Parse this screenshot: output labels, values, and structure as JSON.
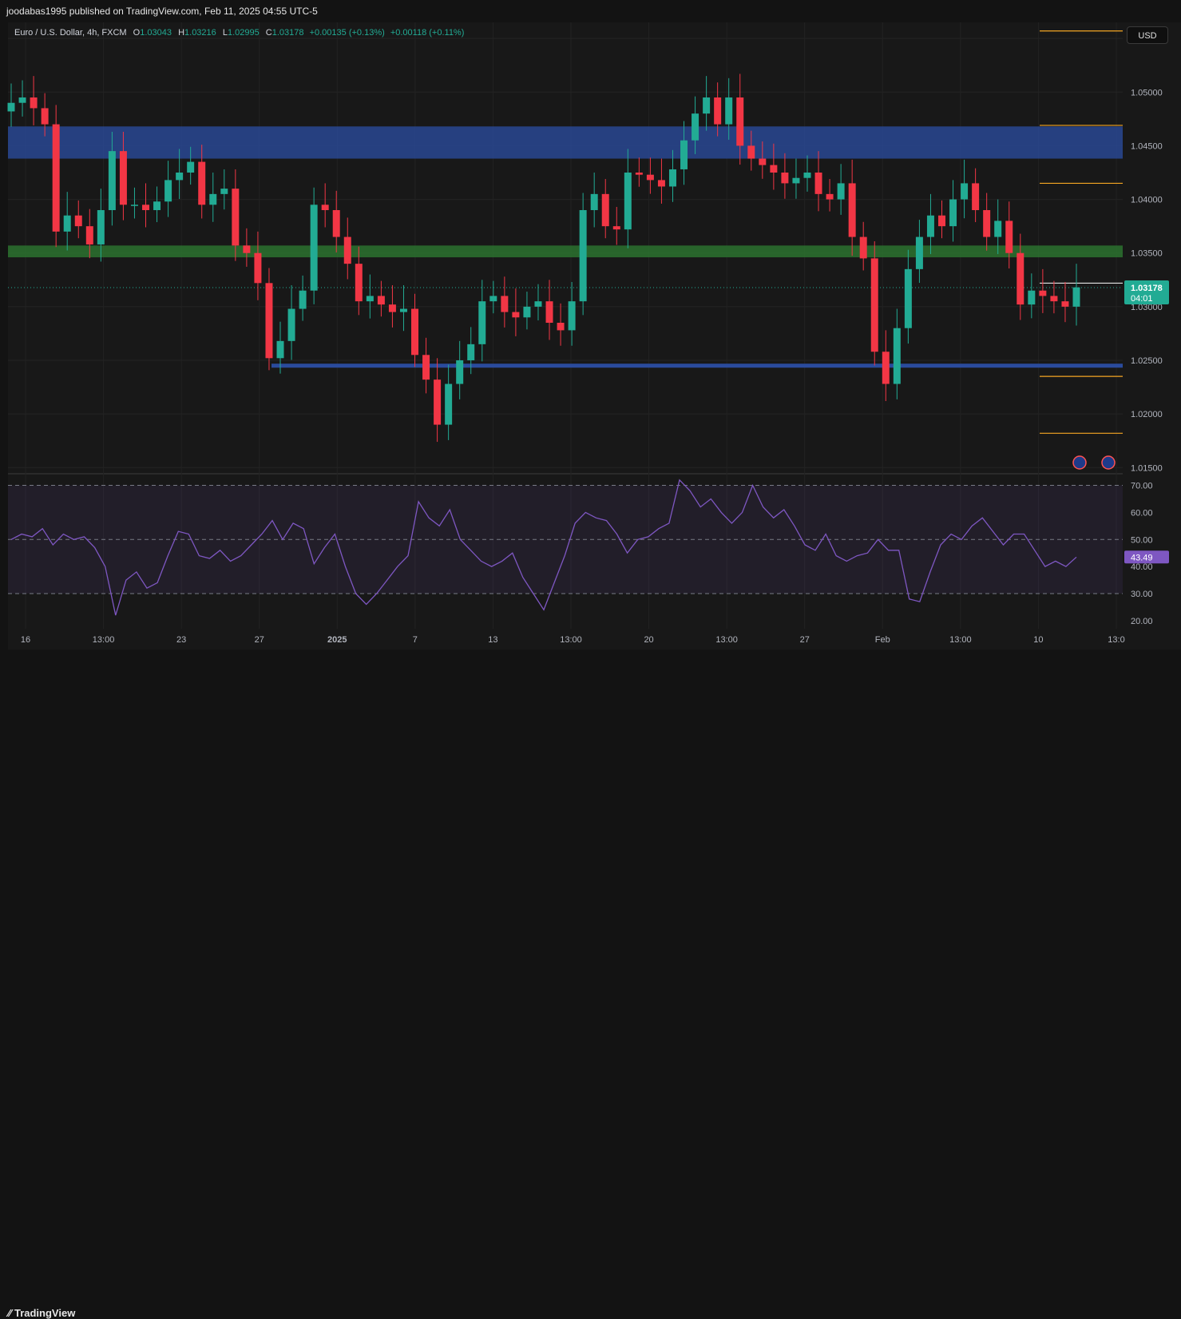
{
  "header": {
    "publisher_line": "joodabas1995 published on TradingView.com, Feb 11, 2025 04:55 UTC-5"
  },
  "legend": {
    "symbol": "Euro / U.S. Dollar, 4h, FXCM",
    "open_label": "O",
    "open": "1.03043",
    "high_label": "H",
    "high": "1.03216",
    "low_label": "L",
    "low": "1.02995",
    "close_label": "C",
    "close": "1.03178",
    "change": "+0.00135 (+0.13%)",
    "change2": "+0.00118 (+0.11%)"
  },
  "currency_button": "USD",
  "last_price": {
    "value": "1.03178",
    "countdown": "04:01",
    "color": "#22ab94"
  },
  "rsi_value": {
    "value": "43.49",
    "color": "#7e57c2"
  },
  "footer": {
    "brand": "TradingView"
  },
  "colors": {
    "up": "#22ab94",
    "down": "#f23645",
    "supply_zone": "#2b4ea3",
    "demand_zone": "#2e7d32",
    "support_line": "#2b4ea3",
    "rsi": "#7e57c2",
    "target_lines": "#f5a623"
  },
  "chart_data": [
    {
      "type": "candlestick",
      "title": "Euro / U.S. Dollar, 4h, FXCM",
      "ylim": [
        1.0145,
        1.0565
      ],
      "y_ticks": [
        "1.05500",
        "1.05000",
        "1.04500",
        "1.04000",
        "1.03500",
        "1.03000",
        "1.02500",
        "1.02000",
        "1.01500"
      ],
      "x_ticks": [
        "16",
        "13:00",
        "23",
        "27",
        "2025",
        "7",
        "13",
        "13:00",
        "20",
        "13:00",
        "27",
        "Feb",
        "13:00",
        "10",
        "13:0"
      ],
      "series_close": [
        1.049,
        1.0495,
        1.0485,
        1.047,
        1.037,
        1.0385,
        1.0375,
        1.0358,
        1.039,
        1.0445,
        1.0395,
        1.0395,
        1.039,
        1.0398,
        1.0418,
        1.0425,
        1.0435,
        1.0395,
        1.0405,
        1.041,
        1.0357,
        1.035,
        1.0322,
        1.0252,
        1.0268,
        1.0298,
        1.0315,
        1.0395,
        1.039,
        1.0365,
        1.034,
        1.0305,
        1.031,
        1.0302,
        1.0295,
        1.0298,
        1.0255,
        1.0232,
        1.019,
        1.0228,
        1.025,
        1.0265,
        1.0305,
        1.031,
        1.0295,
        1.029,
        1.03,
        1.0305,
        1.0285,
        1.0278,
        1.0305,
        1.039,
        1.0405,
        1.0375,
        1.0372,
        1.0425,
        1.0423,
        1.0418,
        1.0412,
        1.0428,
        1.0455,
        1.048,
        1.0495,
        1.047,
        1.0495,
        1.045,
        1.0438,
        1.0432,
        1.0425,
        1.0415,
        1.042,
        1.0425,
        1.0405,
        1.04,
        1.0415,
        1.0365,
        1.0345,
        1.0258,
        1.0228,
        1.028,
        1.0335,
        1.0365,
        1.0385,
        1.0375,
        1.04,
        1.0415,
        1.039,
        1.0365,
        1.038,
        1.035,
        1.0302,
        1.0315,
        1.031,
        1.0305,
        1.03,
        1.0318
      ],
      "levels": [
        {
          "name": "supply-zone",
          "from": 1.0438,
          "to": 1.0468
        },
        {
          "name": "demand-zone",
          "from": 1.0346,
          "to": 1.0357
        },
        {
          "name": "support-line",
          "value": 1.0245
        },
        {
          "name": "target",
          "value": 1.0557
        },
        {
          "name": "target",
          "value": 1.0469
        },
        {
          "name": "target",
          "value": 1.0415
        },
        {
          "name": "target",
          "value": 1.0235
        },
        {
          "name": "target",
          "value": 1.0182
        },
        {
          "name": "current-price",
          "value": 1.03178
        }
      ]
    },
    {
      "type": "line",
      "ylim": [
        17,
        74
      ],
      "y_ticks": [
        "70.00",
        "60.00",
        "50.00",
        "40.00",
        "30.00",
        "20.00"
      ],
      "overbought": 70,
      "oversold": 30,
      "midline": 50,
      "values": [
        50,
        52,
        51,
        54,
        48,
        52,
        50,
        51,
        47,
        40,
        22,
        35,
        38,
        32,
        34,
        44,
        53,
        52,
        44,
        43,
        46,
        42,
        44,
        48,
        52,
        57,
        50,
        56,
        54,
        41,
        47,
        52,
        40,
        30,
        26,
        30,
        35,
        40,
        44,
        64,
        58,
        55,
        61,
        50,
        46,
        42,
        40,
        42,
        45,
        36,
        30,
        24,
        34,
        44,
        56,
        60,
        58,
        57,
        52,
        45,
        50,
        51,
        54,
        56,
        72,
        68,
        62,
        65,
        60,
        56,
        60,
        70,
        62,
        58,
        61,
        55,
        48,
        46,
        52,
        44,
        42,
        44,
        45,
        50,
        46,
        46,
        28,
        27,
        38,
        48,
        52,
        50,
        55,
        58,
        53,
        48,
        52,
        52,
        46,
        40,
        42,
        40,
        43.49
      ]
    }
  ]
}
